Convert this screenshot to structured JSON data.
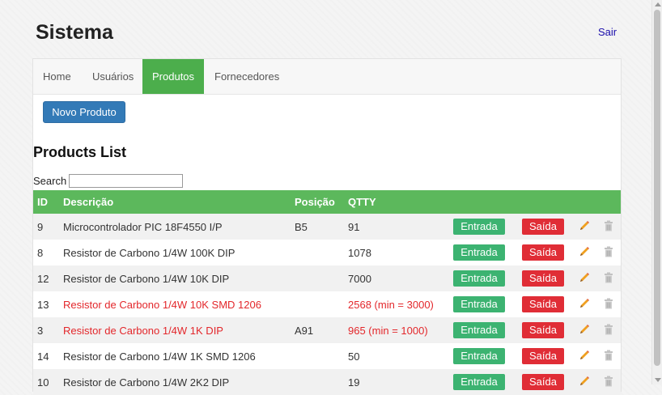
{
  "header": {
    "title": "Sistema",
    "logout": "Sair"
  },
  "nav": [
    {
      "label": "Home",
      "active": false
    },
    {
      "label": "Usuários",
      "active": false
    },
    {
      "label": "Produtos",
      "active": true
    },
    {
      "label": "Fornecedores",
      "active": false
    }
  ],
  "actions": {
    "new_product": "Novo Produto"
  },
  "list": {
    "title": "Products List",
    "search_label": "Search",
    "search_value": ""
  },
  "table": {
    "headers": [
      "ID",
      "Descrição",
      "Posição",
      "QTTY"
    ],
    "in_label": "Entrada",
    "out_label": "Saída",
    "rows": [
      {
        "id": "9",
        "desc": "Microcontrolador PIC 18F4550 I/P",
        "pos": "B5",
        "qty": "91",
        "low": false
      },
      {
        "id": "8",
        "desc": "Resistor de Carbono 1/4W 100K DIP",
        "pos": "",
        "qty": "1078",
        "low": false
      },
      {
        "id": "12",
        "desc": "Resistor de Carbono 1/4W 10K DIP",
        "pos": "",
        "qty": "7000",
        "low": false
      },
      {
        "id": "13",
        "desc": "Resistor de Carbono 1/4W 10K SMD 1206",
        "pos": "",
        "qty": "2568 (min = 3000)",
        "low": true
      },
      {
        "id": "3",
        "desc": "Resistor de Carbono 1/4W 1K DIP",
        "pos": "A91",
        "qty": "965 (min = 1000)",
        "low": true
      },
      {
        "id": "14",
        "desc": "Resistor de Carbono 1/4W 1K SMD 1206",
        "pos": "",
        "qty": "50",
        "low": false
      },
      {
        "id": "10",
        "desc": "Resistor de Carbono 1/4W 2K2 DIP",
        "pos": "",
        "qty": "19",
        "low": false
      }
    ]
  },
  "colors": {
    "accent": "#5cb85c",
    "primary": "#337ab7",
    "danger": "#e02d36",
    "entrada": "#3cb371",
    "low_stock": "#e3272b"
  },
  "icons": {
    "edit": "pencil-icon",
    "delete": "trash-icon"
  }
}
